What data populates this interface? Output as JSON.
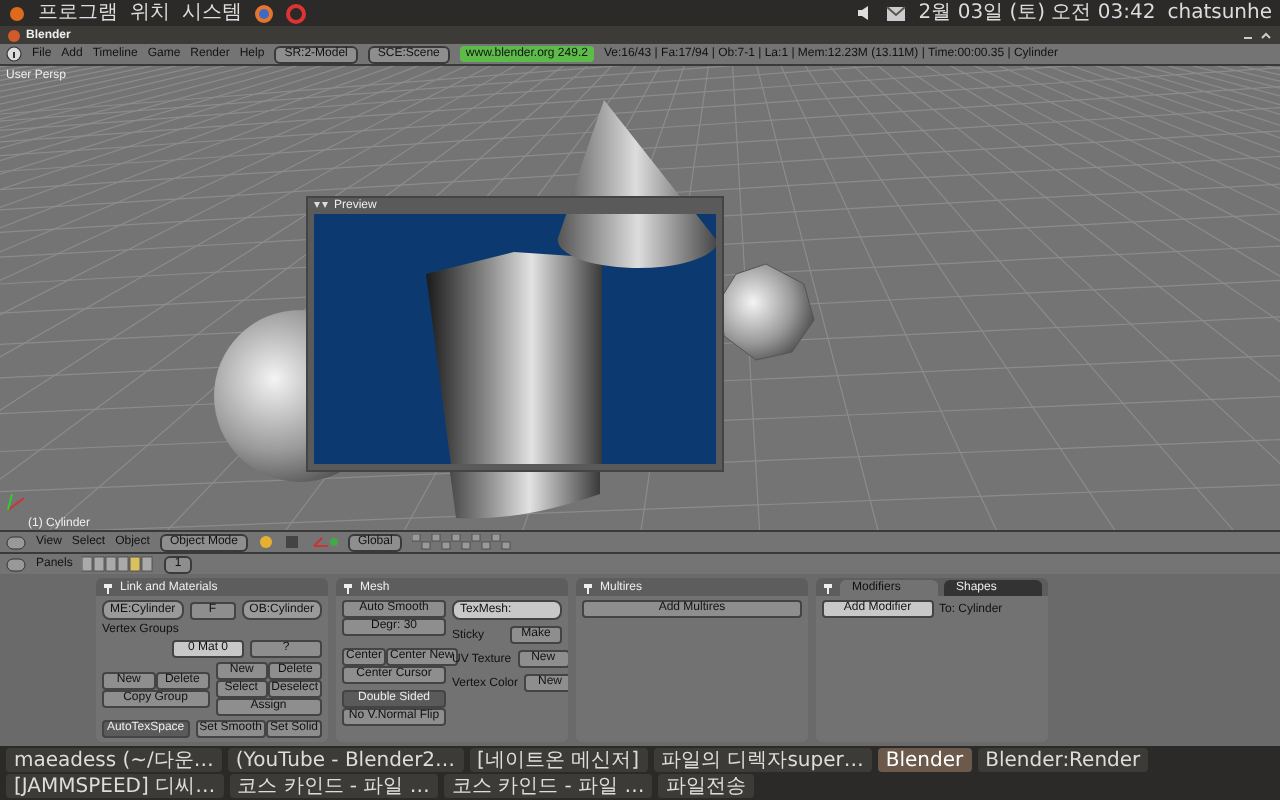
{
  "top_panel": {
    "menus": [
      "프로그램",
      "위치",
      "시스템"
    ],
    "clock": "2월 03일 (토) 오전 03:42",
    "user": "chatsunhe"
  },
  "window": {
    "title": "Blender"
  },
  "header": {
    "menus": [
      "File",
      "Add",
      "Timeline",
      "Game",
      "Render",
      "Help"
    ],
    "screen": "SR:2-Model",
    "scene": "SCE:Scene",
    "version": "www.blender.org 249.2",
    "stats": "Ve:16/43 | Fa:17/94 | Ob:7-1 | La:1 | Mem:12.23M (13.11M) | Time:00:00.35 | Cylinder"
  },
  "viewport": {
    "view_label": "User Persp",
    "object_label": "(1) Cylinder",
    "preview": {
      "title": "Preview"
    }
  },
  "view_header": {
    "menus": [
      "View",
      "Select",
      "Object"
    ],
    "mode": "Object Mode",
    "orientation": "Global"
  },
  "buttons_header": {
    "label": "Panels",
    "frame": "1"
  },
  "panels": [
    {
      "kind": "link_materials",
      "title": "Link and Materials",
      "mesh_field": "ME:Cylinder",
      "mesh_fake": "F",
      "object_field": "OB:Cylinder",
      "groups_label": "Vertex Groups",
      "material_stepper": "0 Mat 0",
      "material_help": "?",
      "group_buttons": [
        "New",
        "Delete",
        "Copy Group"
      ],
      "material_buttons": [
        "New",
        "Delete",
        "Select",
        "Deselect",
        "Assign"
      ],
      "auto_tex_space": {
        "label": "AutoTexSpace",
        "on": true
      },
      "shading_buttons": [
        "Set Smooth",
        "Set Solid"
      ]
    },
    {
      "kind": "mesh",
      "title": "Mesh",
      "auto_smooth": {
        "label": "Auto Smooth",
        "on": false
      },
      "degree": "Degr: 30",
      "tex_mesh": "TexMesh:",
      "attributes": [
        {
          "label": "Sticky",
          "button": "Make"
        },
        {
          "label": "UV Texture",
          "button": "New"
        },
        {
          "label": "Vertex Color",
          "button": "New"
        }
      ],
      "center_buttons": [
        "Center",
        "Center New",
        "Center Cursor"
      ],
      "toggles": [
        {
          "label": "Double Sided",
          "on": true
        },
        {
          "label": "No V.Normal Flip",
          "on": false
        }
      ]
    },
    {
      "kind": "multires",
      "title": "Multires",
      "button": "Add Multires"
    },
    {
      "kind": "modifiers",
      "tabs": [
        {
          "label": "Modifiers",
          "selected": true
        },
        {
          "label": "Shapes",
          "selected": false
        }
      ],
      "menu": "Add Modifier",
      "target": "To: Cylinder"
    }
  ],
  "taskbar": [
    {
      "label": "maeadess (~/다운…",
      "selected": false
    },
    {
      "label": "(YouTube - Blender2…",
      "selected": false
    },
    {
      "label": "[네이트온 메신저]",
      "selected": false
    },
    {
      "label": "파일의 디렉자super…",
      "selected": false
    },
    {
      "label": "Blender",
      "selected": true
    },
    {
      "label": "Blender:Render",
      "selected": false
    },
    {
      "label": "[JAMMSPEED] 디씨…",
      "selected": false
    },
    {
      "label": "코스 카인드 - 파일 …",
      "selected": false
    },
    {
      "label": "코스 카인드 - 파일 …",
      "selected": false
    },
    {
      "label": "파일전송",
      "selected": false
    }
  ]
}
